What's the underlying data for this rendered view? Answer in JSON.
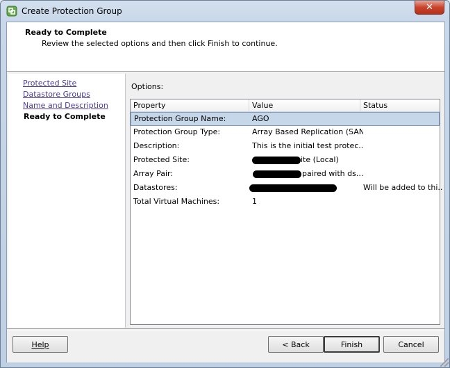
{
  "window": {
    "title": "Create Protection Group",
    "close_label": "✕"
  },
  "header": {
    "title": "Ready to Complete",
    "subtitle": "Review the selected options and then click Finish to continue."
  },
  "nav": {
    "links": [
      "Protected Site",
      "Datastore Groups",
      "Name and Description"
    ],
    "current": "Ready to Complete"
  },
  "options": {
    "label": "Options:",
    "columns": [
      "Property",
      "Value",
      "Status"
    ],
    "rows": [
      {
        "property": "Protection Group Name:",
        "value": "AGO",
        "status": ""
      },
      {
        "property": "Protection Group Type:",
        "value": "Array Based Replication (SAN)",
        "status": ""
      },
      {
        "property": "Description:",
        "value": "This is the initial test protec...",
        "status": ""
      },
      {
        "property": "Protected Site:",
        "value": "ite (Local)",
        "status": ""
      },
      {
        "property": "Array Pair:",
        "value": "paired with ds...",
        "status": ""
      },
      {
        "property": "Datastores:",
        "value": "",
        "status": "Will be added to thi..."
      },
      {
        "property": "Total Virtual Machines:",
        "value": "1",
        "status": ""
      }
    ]
  },
  "buttons": {
    "help": "Help",
    "back": "< Back",
    "finish": "Finish",
    "cancel": "Cancel"
  }
}
